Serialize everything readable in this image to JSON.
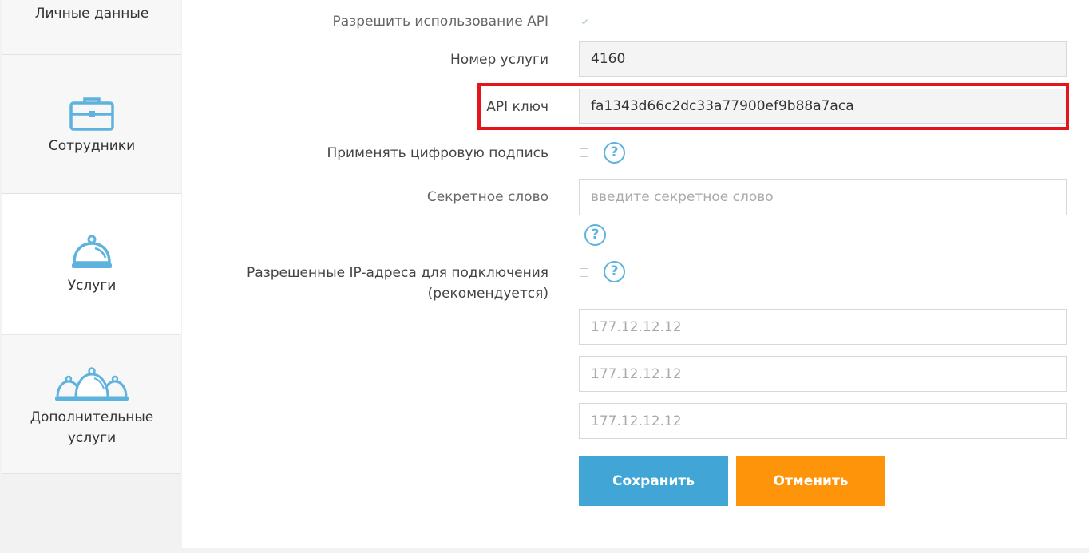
{
  "sidebar": {
    "items": [
      {
        "label": "Личные данные",
        "icon": "user-icon"
      },
      {
        "label": "Сотрудники",
        "icon": "briefcase-icon"
      },
      {
        "label": "Услуги",
        "icon": "service-bell-icon",
        "active": true
      },
      {
        "label": "Дополнительные услуги",
        "label_line1": "Дополнительные",
        "label_line2": "услуги",
        "icon": "multiple-bells-icon"
      }
    ]
  },
  "form": {
    "allow_api_label": "Разрешить использование API",
    "allow_api_checked": true,
    "service_number_label": "Номер услуги",
    "service_number_value": "4160",
    "api_key_label": "API ключ",
    "api_key_value": "fa1343d66c2dc33a77900ef9b88a7aca",
    "digital_signature_label": "Применять цифровую подпись",
    "digital_signature_checked": false,
    "secret_word_label": "Секретное слово",
    "secret_word_placeholder": "введите секретное слово",
    "allowed_ip_label_line1": "Разрешенные IP-адреса для подключения",
    "allowed_ip_label_line2": "(рекомендуется)",
    "allowed_ip_checked": false,
    "ip_placeholders": [
      "177.12.12.12",
      "177.12.12.12",
      "177.12.12.12"
    ],
    "help_symbol": "?"
  },
  "buttons": {
    "save_label": "Сохранить",
    "cancel_label": "Отменить"
  },
  "colors": {
    "accent_blue": "#41a6d5",
    "accent_orange": "#fd9409",
    "icon_blue": "#5db2de",
    "highlight_red": "#e3141c"
  }
}
